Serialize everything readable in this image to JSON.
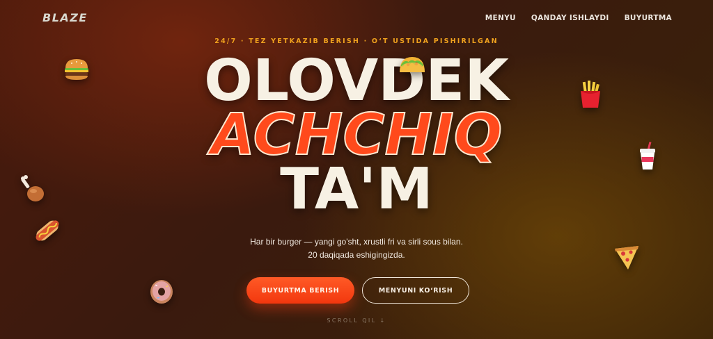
{
  "nav": {
    "logo": "BLAZE",
    "links": [
      "MENYU",
      "QANDAY ISHLAYDI",
      "BUYURTMA"
    ]
  },
  "hero": {
    "tagline": "24/7 · TEZ YETKAZIB BERISH · O‘T USTIDA PISHIRILGAN",
    "headline": [
      "OLOVDEK",
      "ACHCHIQ",
      "TA'M"
    ],
    "description": "Har bir burger — yangi go'sht, xrustli fri va sirli sous bilan. 20 daqiqada eshigingizda.",
    "primary_button": "BUYURTMA BERISH",
    "secondary_button": "MENYUNI KO‘RISH",
    "scroll_hint": "SCROLL QIL ↓"
  },
  "colors": {
    "accent": "#ff4a1c",
    "tagline": "#f0a21e",
    "headline": "#f7f1e4",
    "background_dark": "#3a1a0e"
  },
  "decorations": [
    "burger-icon",
    "taco-icon",
    "fries-icon",
    "drink-cup-icon",
    "chicken-leg-icon",
    "hotdog-icon",
    "pizza-slice-icon",
    "donut-icon"
  ]
}
